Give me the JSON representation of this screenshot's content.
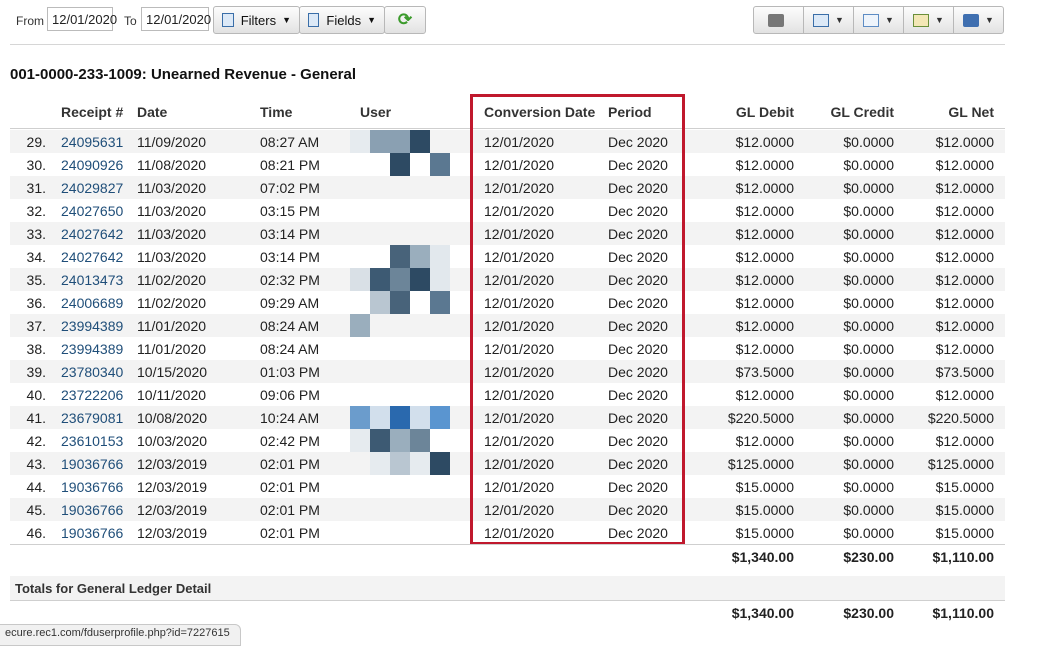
{
  "toolbar": {
    "from_label": "From",
    "from_value": "12/01/2020",
    "to_label": "To",
    "to_value": "12/01/2020",
    "filters_label": "Filters",
    "fields_label": "Fields",
    "icons": [
      "refresh-icon",
      "print-icon",
      "table-icon",
      "email-icon",
      "chart-icon",
      "save-icon"
    ]
  },
  "report": {
    "title": "001-0000-233-1009: Unearned Revenue - General",
    "columns": {
      "receipt": "Receipt #",
      "date": "Date",
      "time": "Time",
      "user": "User",
      "conversion_date": "Conversion Date",
      "period": "Period",
      "gl_debit": "GL Debit",
      "gl_credit": "GL Credit",
      "gl_net": "GL Net"
    },
    "rows": [
      {
        "n": "29.",
        "receipt": "24095631",
        "date": "11/09/2020",
        "time": "08:27 AM",
        "conv": "12/01/2020",
        "period": "Dec 2020",
        "debit": "$12.0000",
        "credit": "$0.0000",
        "net": "$12.0000"
      },
      {
        "n": "30.",
        "receipt": "24090926",
        "date": "11/08/2020",
        "time": "08:21 PM",
        "conv": "12/01/2020",
        "period": "Dec 2020",
        "debit": "$12.0000",
        "credit": "$0.0000",
        "net": "$12.0000"
      },
      {
        "n": "31.",
        "receipt": "24029827",
        "date": "11/03/2020",
        "time": "07:02 PM",
        "conv": "12/01/2020",
        "period": "Dec 2020",
        "debit": "$12.0000",
        "credit": "$0.0000",
        "net": "$12.0000"
      },
      {
        "n": "32.",
        "receipt": "24027650",
        "date": "11/03/2020",
        "time": "03:15 PM",
        "conv": "12/01/2020",
        "period": "Dec 2020",
        "debit": "$12.0000",
        "credit": "$0.0000",
        "net": "$12.0000"
      },
      {
        "n": "33.",
        "receipt": "24027642",
        "date": "11/03/2020",
        "time": "03:14 PM",
        "conv": "12/01/2020",
        "period": "Dec 2020",
        "debit": "$12.0000",
        "credit": "$0.0000",
        "net": "$12.0000"
      },
      {
        "n": "34.",
        "receipt": "24027642",
        "date": "11/03/2020",
        "time": "03:14 PM",
        "conv": "12/01/2020",
        "period": "Dec 2020",
        "debit": "$12.0000",
        "credit": "$0.0000",
        "net": "$12.0000"
      },
      {
        "n": "35.",
        "receipt": "24013473",
        "date": "11/02/2020",
        "time": "02:32 PM",
        "conv": "12/01/2020",
        "period": "Dec 2020",
        "debit": "$12.0000",
        "credit": "$0.0000",
        "net": "$12.0000"
      },
      {
        "n": "36.",
        "receipt": "24006689",
        "date": "11/02/2020",
        "time": "09:29 AM",
        "conv": "12/01/2020",
        "period": "Dec 2020",
        "debit": "$12.0000",
        "credit": "$0.0000",
        "net": "$12.0000"
      },
      {
        "n": "37.",
        "receipt": "23994389",
        "date": "11/01/2020",
        "time": "08:24 AM",
        "conv": "12/01/2020",
        "period": "Dec 2020",
        "debit": "$12.0000",
        "credit": "$0.0000",
        "net": "$12.0000"
      },
      {
        "n": "38.",
        "receipt": "23994389",
        "date": "11/01/2020",
        "time": "08:24 AM",
        "conv": "12/01/2020",
        "period": "Dec 2020",
        "debit": "$12.0000",
        "credit": "$0.0000",
        "net": "$12.0000"
      },
      {
        "n": "39.",
        "receipt": "23780340",
        "date": "10/15/2020",
        "time": "01:03 PM",
        "conv": "12/01/2020",
        "period": "Dec 2020",
        "debit": "$73.5000",
        "credit": "$0.0000",
        "net": "$73.5000"
      },
      {
        "n": "40.",
        "receipt": "23722206",
        "date": "10/11/2020",
        "time": "09:06 PM",
        "conv": "12/01/2020",
        "period": "Dec 2020",
        "debit": "$12.0000",
        "credit": "$0.0000",
        "net": "$12.0000"
      },
      {
        "n": "41.",
        "receipt": "23679081",
        "date": "10/08/2020",
        "time": "10:24 AM",
        "conv": "12/01/2020",
        "period": "Dec 2020",
        "debit": "$220.5000",
        "credit": "$0.0000",
        "net": "$220.5000"
      },
      {
        "n": "42.",
        "receipt": "23610153",
        "date": "10/03/2020",
        "time": "02:42 PM",
        "conv": "12/01/2020",
        "period": "Dec 2020",
        "debit": "$12.0000",
        "credit": "$0.0000",
        "net": "$12.0000"
      },
      {
        "n": "43.",
        "receipt": "19036766",
        "date": "12/03/2019",
        "time": "02:01 PM",
        "conv": "12/01/2020",
        "period": "Dec 2020",
        "debit": "$125.0000",
        "credit": "$0.0000",
        "net": "$125.0000"
      },
      {
        "n": "44.",
        "receipt": "19036766",
        "date": "12/03/2019",
        "time": "02:01 PM",
        "conv": "12/01/2020",
        "period": "Dec 2020",
        "debit": "$15.0000",
        "credit": "$0.0000",
        "net": "$15.0000"
      },
      {
        "n": "45.",
        "receipt": "19036766",
        "date": "12/03/2019",
        "time": "02:01 PM",
        "conv": "12/01/2020",
        "period": "Dec 2020",
        "debit": "$15.0000",
        "credit": "$0.0000",
        "net": "$15.0000"
      },
      {
        "n": "46.",
        "receipt": "19036766",
        "date": "12/03/2019",
        "time": "02:01 PM",
        "conv": "12/01/2020",
        "period": "Dec 2020",
        "debit": "$15.0000",
        "credit": "$0.0000",
        "net": "$15.0000"
      }
    ],
    "totals": {
      "debit": "$1,340.00",
      "credit": "$230.00",
      "net": "$1,110.00"
    }
  },
  "gl_totals": {
    "title": "Totals for General Ledger Detail",
    "debit": "$1,340.00",
    "credit": "$230.00",
    "net": "$1,110.00"
  },
  "status_bar": {
    "url": "ecure.rec1.com/fduserprofile.php?id=7227615"
  },
  "colors": {
    "highlight_box": "#c0182d",
    "link": "#1f4e79",
    "row_alt": "#f3f3f3"
  }
}
